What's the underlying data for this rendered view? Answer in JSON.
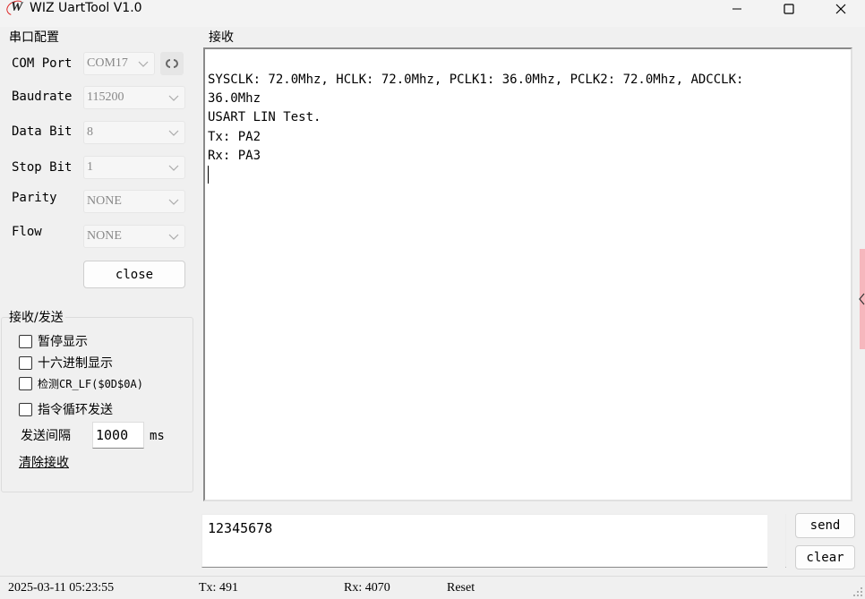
{
  "window": {
    "title": "WIZ UartTool V1.0",
    "logo_text": "W"
  },
  "serial_config": {
    "group_label": "串口配置",
    "com_port": {
      "label": "COM Port",
      "value": "COM17"
    },
    "baudrate": {
      "label": "Baudrate",
      "value": "115200"
    },
    "data_bit": {
      "label": "Data Bit",
      "value": "8"
    },
    "stop_bit": {
      "label": "Stop Bit",
      "value": "1"
    },
    "parity": {
      "label": "Parity",
      "value": "NONE"
    },
    "flow": {
      "label": "Flow",
      "value": "NONE"
    },
    "close_label": "close"
  },
  "recv_send": {
    "group_label": "接收/发送",
    "pause_display": "暂停显示",
    "hex_display": "十六进制显示",
    "detect_crlf": "检测CR_LF($0D$0A)",
    "loop_send": "指令循环发送",
    "interval_label": "发送间隔",
    "interval_value": "1000",
    "interval_unit": "ms",
    "clear_recv": "清除接收"
  },
  "receive": {
    "label": "接收",
    "lines": [
      "SYSCLK: 72.0Mhz, HCLK: 72.0Mhz, PCLK1: 36.0Mhz, PCLK2: 72.0Mhz, ADCCLK:",
      "36.0Mhz",
      "USART LIN Test.",
      "Tx: PA2",
      "Rx: PA3"
    ]
  },
  "send": {
    "text": "12345678",
    "send_label": "send",
    "clear_label": "clear"
  },
  "status": {
    "datetime": "2025-03-11 05:23:55",
    "tx": "Tx: 491",
    "rx": "Rx: 4070",
    "reset": "Reset"
  },
  "colors": {
    "side_strip": "#f6b7bd",
    "logo_ring": "#dd2222"
  }
}
